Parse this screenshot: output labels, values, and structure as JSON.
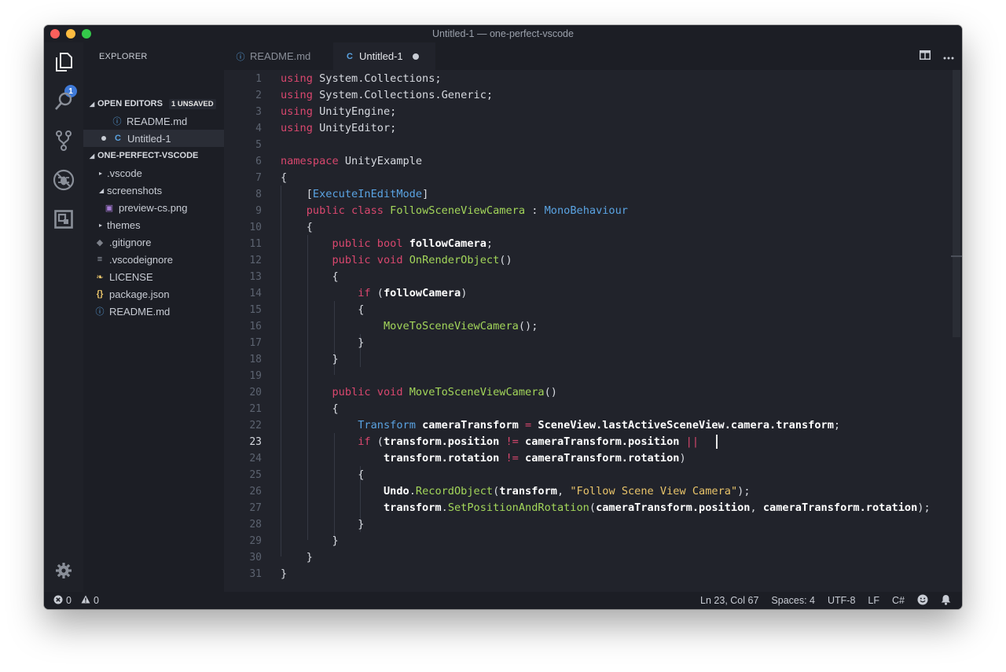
{
  "window": {
    "title": "Untitled-1 — one-perfect-vscode"
  },
  "activity": {
    "badge": "1"
  },
  "explorer": {
    "title": "EXPLORER",
    "open_editors": {
      "label": "OPEN EDITORS",
      "badge": "1 UNSAVED",
      "items": [
        "README.md",
        "Untitled-1"
      ]
    },
    "project": {
      "label": "ONE-PERFECT-VSCODE",
      "items": [
        ".vscode",
        "screenshots",
        "preview-cs.png",
        "themes",
        ".gitignore",
        ".vscodeignore",
        "LICENSE",
        "package.json",
        "README.md"
      ]
    }
  },
  "tabs": [
    {
      "label": "README.md",
      "active": false
    },
    {
      "label": "Untitled-1",
      "active": true,
      "modified": true
    }
  ],
  "editor": {
    "current_line": 23,
    "lines": [
      [
        [
          "k",
          "using"
        ],
        [
          "p",
          " System.Collections;"
        ]
      ],
      [
        [
          "k",
          "using"
        ],
        [
          "p",
          " System.Collections.Generic;"
        ]
      ],
      [
        [
          "k",
          "using"
        ],
        [
          "p",
          " UnityEngine;"
        ]
      ],
      [
        [
          "k",
          "using"
        ],
        [
          "p",
          " UnityEditor;"
        ]
      ],
      [],
      [
        [
          "k",
          "namespace"
        ],
        [
          "p",
          " UnityExample"
        ]
      ],
      [
        [
          "p",
          "{"
        ]
      ],
      [
        [
          "p",
          "    ["
        ],
        [
          "b",
          "ExecuteInEditMode"
        ],
        [
          "p",
          "]"
        ]
      ],
      [
        [
          "p",
          "    "
        ],
        [
          "k",
          "public class"
        ],
        [
          "p",
          " "
        ],
        [
          "t",
          "FollowSceneViewCamera"
        ],
        [
          "p",
          " : "
        ],
        [
          "b",
          "MonoBehaviour"
        ]
      ],
      [
        [
          "p",
          "    {"
        ]
      ],
      [
        [
          "p",
          "        "
        ],
        [
          "k",
          "public bool"
        ],
        [
          "p",
          " "
        ],
        [
          "w",
          "followCamera"
        ],
        [
          "p",
          ";"
        ]
      ],
      [
        [
          "p",
          "        "
        ],
        [
          "k",
          "public void"
        ],
        [
          "p",
          " "
        ],
        [
          "f",
          "OnRenderObject"
        ],
        [
          "p",
          "()"
        ]
      ],
      [
        [
          "p",
          "        {"
        ]
      ],
      [
        [
          "p",
          "            "
        ],
        [
          "k",
          "if"
        ],
        [
          "p",
          " ("
        ],
        [
          "w",
          "followCamera"
        ],
        [
          "p",
          ")"
        ]
      ],
      [
        [
          "p",
          "            {"
        ]
      ],
      [
        [
          "p",
          "                "
        ],
        [
          "f",
          "MoveToSceneViewCamera"
        ],
        [
          "p",
          "();"
        ]
      ],
      [
        [
          "p",
          "            }"
        ]
      ],
      [
        [
          "p",
          "        }"
        ]
      ],
      [],
      [
        [
          "p",
          "        "
        ],
        [
          "k",
          "public void"
        ],
        [
          "p",
          " "
        ],
        [
          "f",
          "MoveToSceneViewCamera"
        ],
        [
          "p",
          "()"
        ]
      ],
      [
        [
          "p",
          "        {"
        ]
      ],
      [
        [
          "p",
          "            "
        ],
        [
          "b",
          "Transform"
        ],
        [
          "p",
          " "
        ],
        [
          "w",
          "cameraTransform"
        ],
        [
          "p",
          " "
        ],
        [
          "k",
          "="
        ],
        [
          "p",
          " "
        ],
        [
          "w",
          "SceneView.lastActiveSceneView.camera.transform"
        ],
        [
          "p",
          ";"
        ]
      ],
      [
        [
          "p",
          "            "
        ],
        [
          "k",
          "if"
        ],
        [
          "p",
          " ("
        ],
        [
          "w",
          "transform.position"
        ],
        [
          "p",
          " "
        ],
        [
          "k",
          "!="
        ],
        [
          "p",
          " "
        ],
        [
          "w",
          "cameraTransform.position"
        ],
        [
          "p",
          " "
        ],
        [
          "k",
          "||"
        ],
        [
          "p",
          " "
        ]
      ],
      [
        [
          "p",
          "                "
        ],
        [
          "w",
          "transform.rotation"
        ],
        [
          "p",
          " "
        ],
        [
          "k",
          "!="
        ],
        [
          "p",
          " "
        ],
        [
          "w",
          "cameraTransform.rotation"
        ],
        [
          "p",
          ")"
        ]
      ],
      [
        [
          "p",
          "            {"
        ]
      ],
      [
        [
          "p",
          "                "
        ],
        [
          "w",
          "Undo"
        ],
        [
          "p",
          "."
        ],
        [
          "f",
          "RecordObject"
        ],
        [
          "p",
          "("
        ],
        [
          "w",
          "transform"
        ],
        [
          "p",
          ", "
        ],
        [
          "s",
          "\"Follow Scene View Camera\""
        ],
        [
          "p",
          ");"
        ]
      ],
      [
        [
          "p",
          "                "
        ],
        [
          "w",
          "transform"
        ],
        [
          "p",
          "."
        ],
        [
          "f",
          "SetPositionAndRotation"
        ],
        [
          "p",
          "("
        ],
        [
          "w",
          "cameraTransform.position"
        ],
        [
          "p",
          ", "
        ],
        [
          "w",
          "cameraTransform.rotation"
        ],
        [
          "p",
          ");"
        ]
      ],
      [
        [
          "p",
          "            }"
        ]
      ],
      [
        [
          "p",
          "        }"
        ]
      ],
      [
        [
          "p",
          "    }"
        ]
      ],
      [
        [
          "p",
          "}"
        ]
      ]
    ]
  },
  "status": {
    "errors": "0",
    "warnings": "0",
    "position": "Ln 23, Col 67",
    "spaces": "Spaces: 4",
    "encoding": "UTF-8",
    "eol": "LF",
    "language": "C#"
  },
  "colors": {
    "keyword": "#d9476e",
    "type": "#a3d65a",
    "string": "#e9c46a",
    "builtin": "#5aa3e2",
    "background": "#21232b",
    "sidebar": "#1c1e25"
  },
  "icons": [
    "files-icon",
    "search-icon",
    "source-control-icon",
    "debug-icon",
    "extensions-icon",
    "gear-icon",
    "split-editor-icon",
    "more-icon",
    "error-icon",
    "warning-icon",
    "smiley-icon",
    "bell-icon"
  ]
}
